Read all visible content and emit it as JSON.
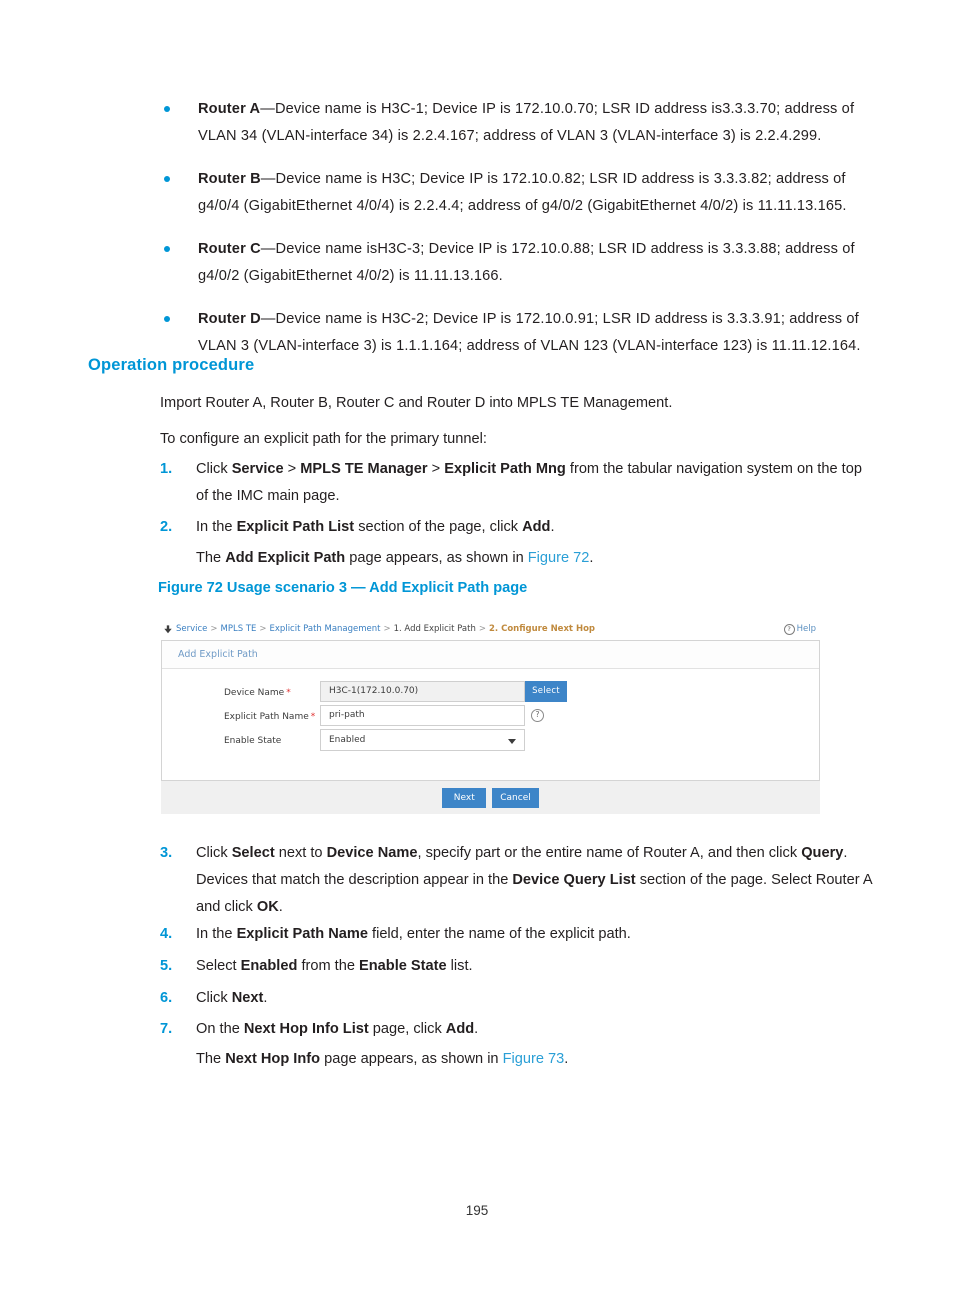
{
  "bullets": [
    {
      "lead": "Router A",
      "text": "—Device name is H3C-1; Device IP is 172.10.0.70; LSR ID address is3.3.3.70; address of VLAN 34 (VLAN-interface 34) is 2.2.4.167; address of VLAN 3 (VLAN-interface 3) is 2.2.4.299."
    },
    {
      "lead": "Router B",
      "text": "—Device name is H3C; Device IP is 172.10.0.82; LSR ID address is 3.3.3.82; address of g4/0/4 (GigabitEthernet 4/0/4) is 2.2.4.4; address of g4/0/2 (GigabitEthernet 4/0/2) is 11.11.13.165."
    },
    {
      "lead": "Router C",
      "text": "—Device name isH3C-3; Device IP is 172.10.0.88; LSR ID address is 3.3.3.88; address of g4/0/2 (GigabitEthernet 4/0/2) is 11.11.13.166."
    },
    {
      "lead": "Router D",
      "text": "—Device name is H3C-2; Device IP is 172.10.0.91; LSR ID address is 3.3.3.91; address of VLAN 3 (VLAN-interface 3) is 1.1.1.164; address of VLAN 123 (VLAN-interface 123) is 11.11.12.164."
    }
  ],
  "section": {
    "heading": "Operation procedure",
    "intro": "Import Router A, Router B, Router C and Router D into MPLS TE Management.",
    "lead_in": "To configure an explicit path for the primary tunnel:"
  },
  "steps": {
    "s1": {
      "num": "1.",
      "text": "Click <b>Service</b> > <b>MPLS TE Manager</b> > <b>Explicit Path Mng</b> from the tabular navigation system on the top of the IMC main page."
    },
    "s2": {
      "num": "2.",
      "text": "In the <b>Explicit Path List</b> section of the page, click <b>Add</b>."
    },
    "s2note": {
      "text": "The <b>Add Explicit Path</b> page appears, as shown in <span class=\"sublink\">Figure 72</span>."
    },
    "s3": {
      "num": "3.",
      "text": "Click <b>Select</b> next to <b>Device Name</b>, specify part or the entire name of Router A, and then click <b>Query</b>. Devices that match the description appear in the <b>Device Query List</b> section of the page. Select Router A and click <b>OK</b>."
    },
    "s4": {
      "num": "4.",
      "text": "In the <b>Explicit Path Name</b> field, enter the name of the explicit path."
    },
    "s5": {
      "num": "5.",
      "text": "Select <b>Enabled</b> from the <b>Enable State</b> list."
    },
    "s6": {
      "num": "6.",
      "text": "Click <b>Next</b>."
    },
    "s7": {
      "num": "7.",
      "text": "On the <b>Next Hop Info List</b> page, click <b>Add</b>."
    },
    "s7note": {
      "text": "The <b>Next Hop Info</b> page appears, as shown in <span class=\"sublink\">Figure 73</span>."
    }
  },
  "figure": {
    "caption": "Figure 72 Usage scenario 3 — Add Explicit Path page",
    "breadcrumb": {
      "home_icon": "home-icon",
      "items": [
        {
          "label": "Service",
          "type": "link"
        },
        {
          "label": "MPLS TE",
          "type": "link"
        },
        {
          "label": "Explicit Path Management",
          "type": "link"
        },
        {
          "label": "1. Add Explicit Path",
          "type": "plain"
        },
        {
          "label": "2. Configure Next Hop",
          "type": "current"
        }
      ],
      "separator": ">",
      "help_label": "Help",
      "help_icon": "question-circle-icon"
    },
    "panel_title": "Add Explicit Path",
    "form": {
      "device_name": {
        "label": "Device Name",
        "required_mark": "*",
        "value": "H3C-1(172.10.0.70)",
        "button_label": "Select"
      },
      "explicit_path_name": {
        "label": "Explicit Path Name",
        "required_mark": "*",
        "value": "pri-path",
        "hint_icon": "question-circle-icon",
        "hint_glyph": "?"
      },
      "enable_state": {
        "label": "Enable State",
        "value": "Enabled",
        "caret_icon": "chevron-down-icon"
      }
    },
    "footer": {
      "next_label": "Next",
      "cancel_label": "Cancel"
    }
  },
  "page_number": "195",
  "colors": {
    "accent_blue": "#0096d6",
    "link_blue": "#2a9fd6",
    "ui_blue": "#3d85c8",
    "breadcrumb_current": "#c08a3e",
    "required_red": "#e03131"
  }
}
